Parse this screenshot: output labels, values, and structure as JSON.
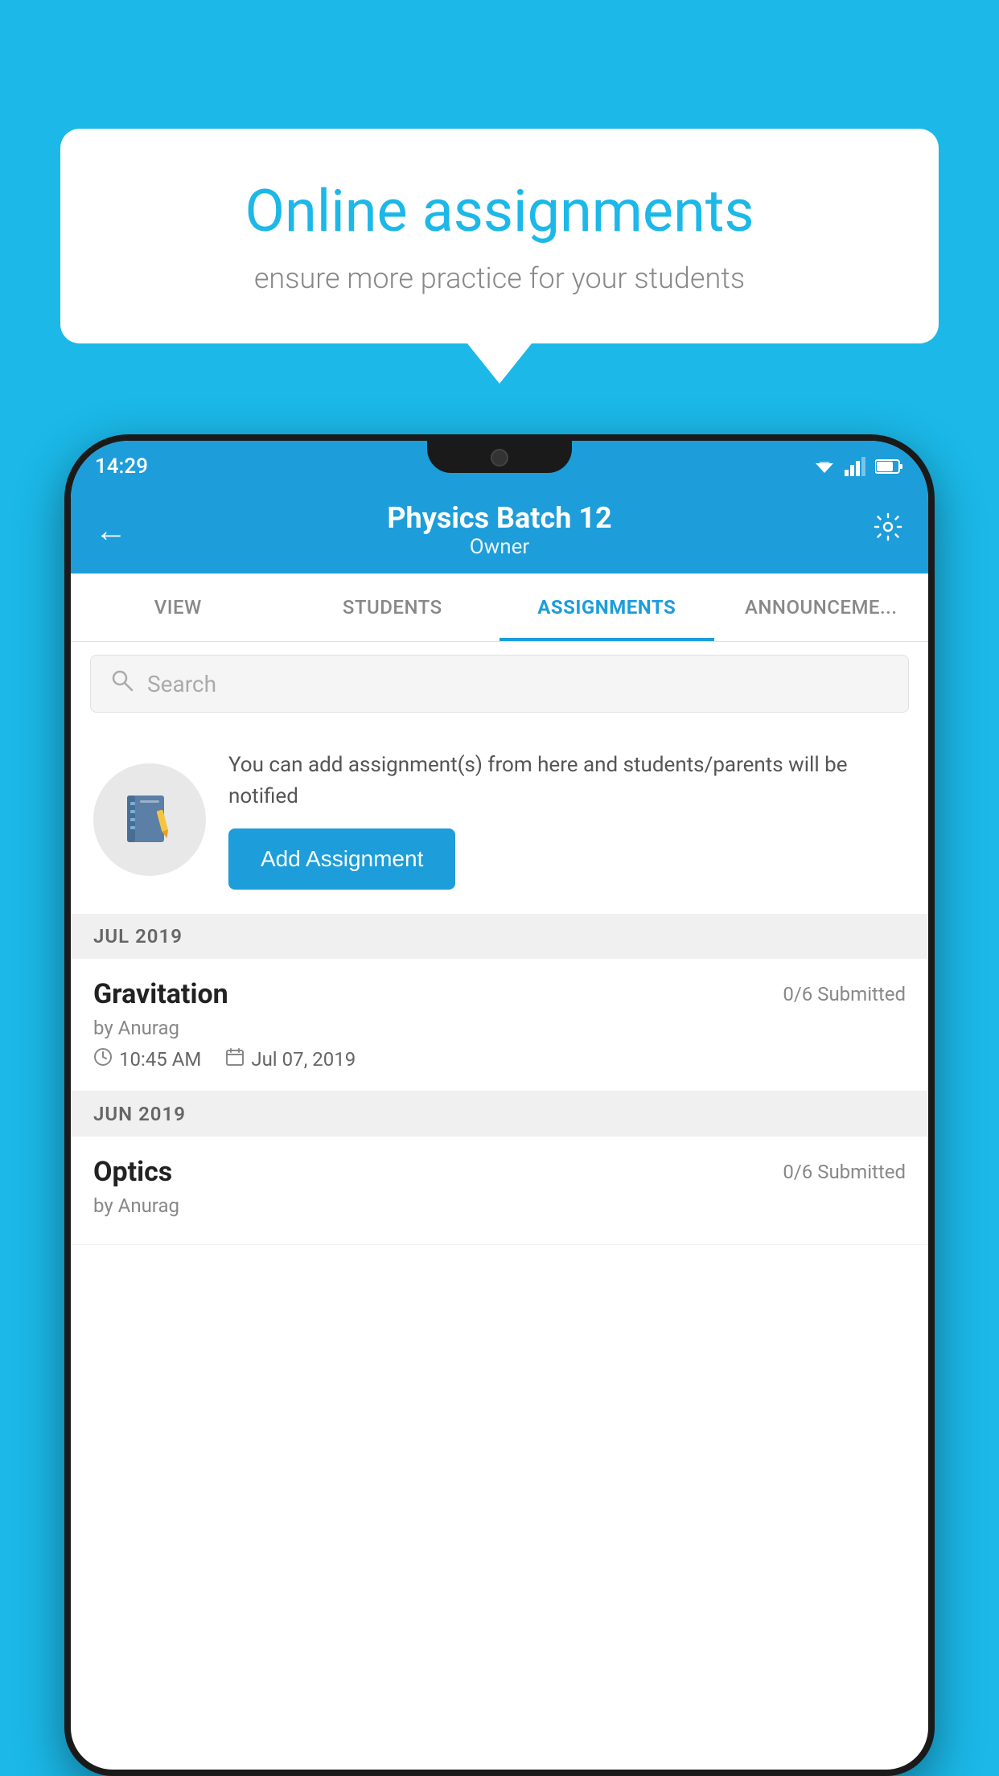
{
  "background_color": "#1BB8E8",
  "speech_bubble": {
    "title": "Online assignments",
    "subtitle": "ensure more practice for your students"
  },
  "status_bar": {
    "time": "14:29"
  },
  "header": {
    "title": "Physics Batch 12",
    "subtitle": "Owner"
  },
  "tabs": [
    {
      "id": "view",
      "label": "VIEW",
      "active": false
    },
    {
      "id": "students",
      "label": "STUDENTS",
      "active": false
    },
    {
      "id": "assignments",
      "label": "ASSIGNMENTS",
      "active": true
    },
    {
      "id": "announcements",
      "label": "ANNOUNCEMENTS",
      "active": false
    }
  ],
  "search": {
    "placeholder": "Search"
  },
  "info_card": {
    "description": "You can add assignment(s) from here and students/parents will be notified",
    "button_label": "Add Assignment"
  },
  "assignment_sections": [
    {
      "month_label": "JUL 2019",
      "assignments": [
        {
          "name": "Gravitation",
          "submitted": "0/6 Submitted",
          "by": "by Anurag",
          "time": "10:45 AM",
          "date": "Jul 07, 2019"
        }
      ]
    },
    {
      "month_label": "JUN 2019",
      "assignments": [
        {
          "name": "Optics",
          "submitted": "0/6 Submitted",
          "by": "by Anurag",
          "time": "",
          "date": ""
        }
      ]
    }
  ]
}
